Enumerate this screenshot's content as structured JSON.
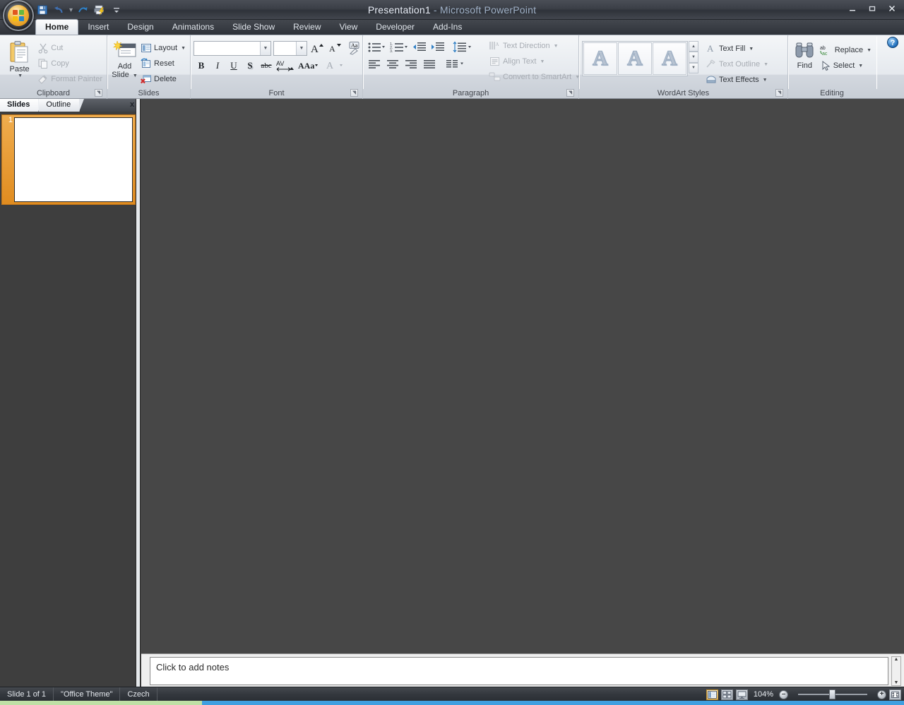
{
  "window": {
    "title_main": "Presentation1",
    "title_suffix": " - Microsoft PowerPoint",
    "minimize": "–",
    "restore": "❐",
    "close": "✕",
    "help": "?"
  },
  "quick_access": {
    "items": [
      {
        "name": "save",
        "label": "Save"
      },
      {
        "name": "undo",
        "label": "Undo"
      },
      {
        "name": "undo-dropdown",
        "label": "▾"
      },
      {
        "name": "redo",
        "label": "Repeat"
      },
      {
        "name": "quick-print",
        "label": "Quick Print"
      },
      {
        "name": "customize",
        "label": "Customize Quick Access Toolbar"
      }
    ]
  },
  "ribbon": {
    "tabs": [
      {
        "label": "Home",
        "active": true
      },
      {
        "label": "Insert",
        "active": false
      },
      {
        "label": "Design",
        "active": false
      },
      {
        "label": "Animations",
        "active": false
      },
      {
        "label": "Slide Show",
        "active": false
      },
      {
        "label": "Review",
        "active": false
      },
      {
        "label": "View",
        "active": false
      },
      {
        "label": "Developer",
        "active": false
      },
      {
        "label": "Add-Ins",
        "active": false
      }
    ],
    "clipboard": {
      "group_label": "Clipboard",
      "paste": "Paste",
      "cut": "Cut",
      "copy": "Copy",
      "format_painter": "Format Painter"
    },
    "slides": {
      "group_label": "Slides",
      "add_slide_line1": "Add",
      "add_slide_line2": "Slide",
      "layout": "Layout",
      "reset": "Reset",
      "delete": "Delete"
    },
    "font": {
      "group_label": "Font",
      "font_name_value": "",
      "font_name_placeholder": "",
      "font_size_value": "",
      "grow_font": "A",
      "shrink_font": "A",
      "clear_formatting": "Aa",
      "bold": "B",
      "italic": "I",
      "underline": "U",
      "shadow": "S",
      "strikethrough": "abc",
      "character_spacing": "AV",
      "change_case": "Aa",
      "font_color": "A"
    },
    "paragraph": {
      "group_label": "Paragraph",
      "text_direction": "Text Direction",
      "align_text": "Align Text",
      "convert_to_smartart": "Convert to SmartArt"
    },
    "wordart": {
      "group_label": "WordArt Styles",
      "gallery": [
        "A",
        "A",
        "A"
      ],
      "text_fill": "Text Fill",
      "text_outline": "Text Outline",
      "text_effects": "Text Effects"
    },
    "editing": {
      "group_label": "Editing",
      "find": "Find",
      "replace": "Replace",
      "select": "Select"
    }
  },
  "left_pane": {
    "tabs": [
      {
        "label": "Slides",
        "active": true
      },
      {
        "label": "Outline",
        "active": false
      }
    ],
    "close_label": "x",
    "slide_number": "1"
  },
  "notes": {
    "placeholder": "Click to add notes"
  },
  "status_bar": {
    "slide_count": "Slide 1 of 1",
    "theme": "\"Office Theme\"",
    "language": "Czech",
    "zoom_level": "104%",
    "zoom_out": "–",
    "zoom_in": "+",
    "views": [
      {
        "name": "normal-view",
        "active": true
      },
      {
        "name": "slide-sorter-view",
        "active": false
      },
      {
        "name": "slide-show-view",
        "active": false
      }
    ],
    "fit_to_window": "Fit slide to current window"
  },
  "colors": {
    "accent_orange": "#f0ad4e",
    "workspace": "#474747",
    "titlebar": "#3b3f47",
    "taskbar_blue": "#3f9fe0"
  }
}
